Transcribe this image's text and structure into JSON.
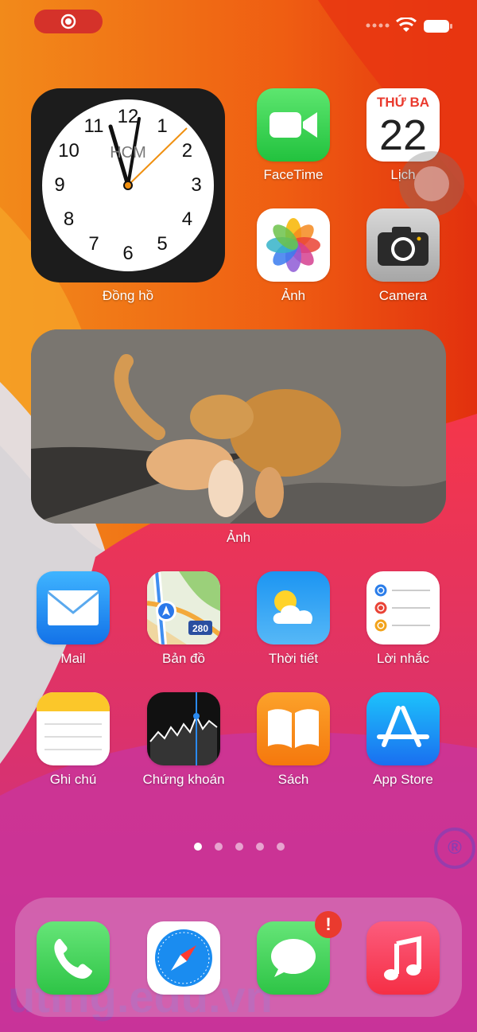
{
  "status_bar": {
    "recording": true
  },
  "clock_widget": {
    "city": "HCM",
    "hour_numbers": [
      "12",
      "1",
      "2",
      "3",
      "4",
      "5",
      "6",
      "7",
      "8",
      "9",
      "10",
      "11"
    ],
    "label": "Đồng hồ"
  },
  "calendar": {
    "weekday": "THỨ BA",
    "day": "22",
    "label": "Lịch"
  },
  "apps_top": [
    {
      "label": "FaceTime"
    },
    {
      "label": "Ảnh"
    },
    {
      "label": "Camera"
    }
  ],
  "photo_widget": {
    "label": "Ảnh"
  },
  "apps_row1": [
    {
      "label": "Mail"
    },
    {
      "label": "Bản đồ",
      "route_badge": "280"
    },
    {
      "label": "Thời tiết"
    },
    {
      "label": "Lời nhắc"
    }
  ],
  "apps_row2": [
    {
      "label": "Ghi chú"
    },
    {
      "label": "Chứng khoán"
    },
    {
      "label": "Sách"
    },
    {
      "label": "App Store"
    }
  ],
  "page_indicator": {
    "pages": 5,
    "current": 1
  },
  "dock": {
    "apps": [
      "phone-icon",
      "safari-icon",
      "messages-icon",
      "music-icon"
    ],
    "messages_badge": "!"
  },
  "watermark": {
    "text": "uting.edu.vn",
    "registered": "®"
  },
  "colors": {
    "accent_red": "#ea3a2e",
    "facetime_green": "#2fcb4c",
    "mail_blue": "#1f8cf3"
  }
}
